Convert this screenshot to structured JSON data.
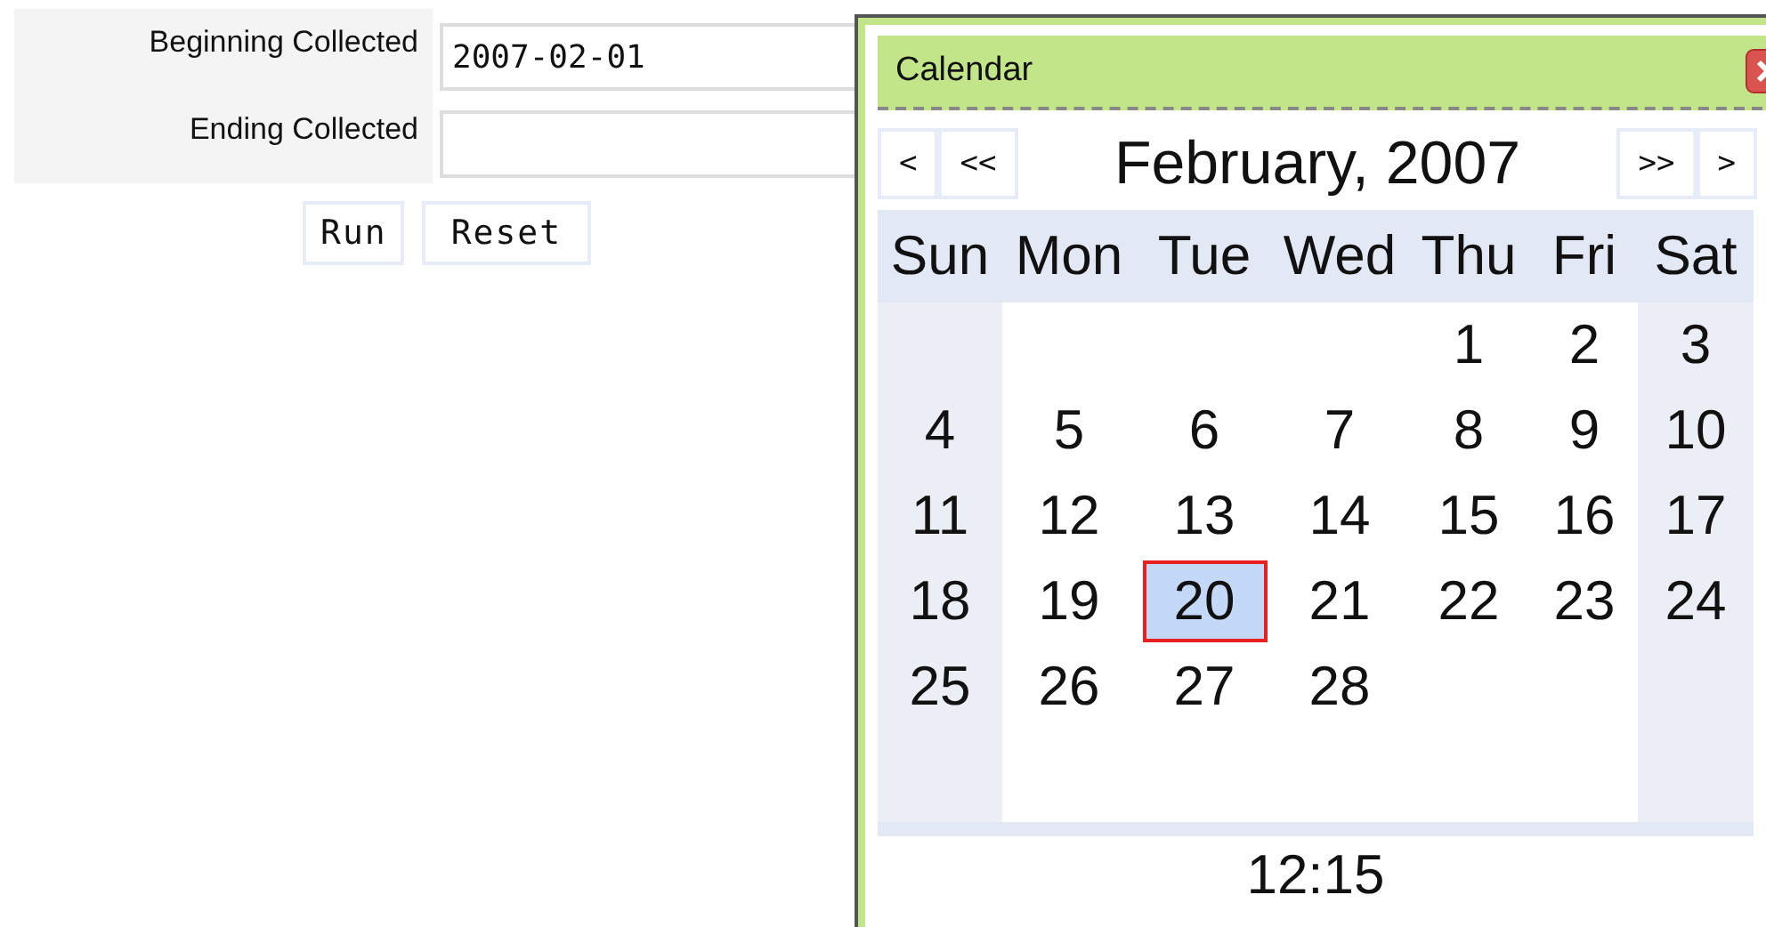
{
  "form": {
    "fields": [
      {
        "label": "Beginning Collected",
        "value": "2007-02-01"
      },
      {
        "label": "Ending Collected"
      }
    ],
    "buttons": [
      "Run",
      "Reset"
    ]
  },
  "calendar": {
    "title": "Calendar",
    "nav": {
      "prev_month": "<",
      "prev_year": "<<",
      "month": "February, 2007",
      "next_year": ">>",
      "next_month": ">"
    },
    "weekdays": [
      "Sun",
      "Mon",
      "Tue",
      "Wed",
      "Thu",
      "Fri",
      "Sat"
    ],
    "weeks": [
      {
        "kind": "leading",
        "days": [
          {
            "label": "1",
            "selected": false
          },
          {
            "label": "2",
            "selected": false
          },
          {
            "label": "3",
            "selected": false
          }
        ]
      },
      {
        "kind": "full",
        "days": [
          {
            "label": "4",
            "selected": false
          },
          {
            "label": "5",
            "selected": false
          },
          {
            "label": "6",
            "selected": false
          },
          {
            "label": "7",
            "selected": false
          },
          {
            "label": "8",
            "selected": false
          },
          {
            "label": "9",
            "selected": false
          },
          {
            "label": "10",
            "selected": false
          }
        ]
      },
      {
        "kind": "full",
        "days": [
          {
            "label": "11",
            "selected": false
          },
          {
            "label": "12",
            "selected": false
          },
          {
            "label": "13",
            "selected": false
          },
          {
            "label": "14",
            "selected": false
          },
          {
            "label": "15",
            "selected": false
          },
          {
            "label": "16",
            "selected": false
          },
          {
            "label": "17",
            "selected": false
          }
        ]
      },
      {
        "kind": "full",
        "days": [
          {
            "label": "18",
            "selected": false
          },
          {
            "label": "19",
            "selected": false
          },
          {
            "label": "20",
            "selected": true
          },
          {
            "label": "21",
            "selected": false
          },
          {
            "label": "22",
            "selected": false
          },
          {
            "label": "23",
            "selected": false
          },
          {
            "label": "24",
            "selected": false
          }
        ]
      },
      {
        "kind": "trailing",
        "days": [
          {
            "label": "25",
            "selected": false
          },
          {
            "label": "26",
            "selected": false
          },
          {
            "label": "27",
            "selected": false
          },
          {
            "label": "28",
            "selected": false
          }
        ]
      }
    ],
    "time": "12:15"
  }
}
